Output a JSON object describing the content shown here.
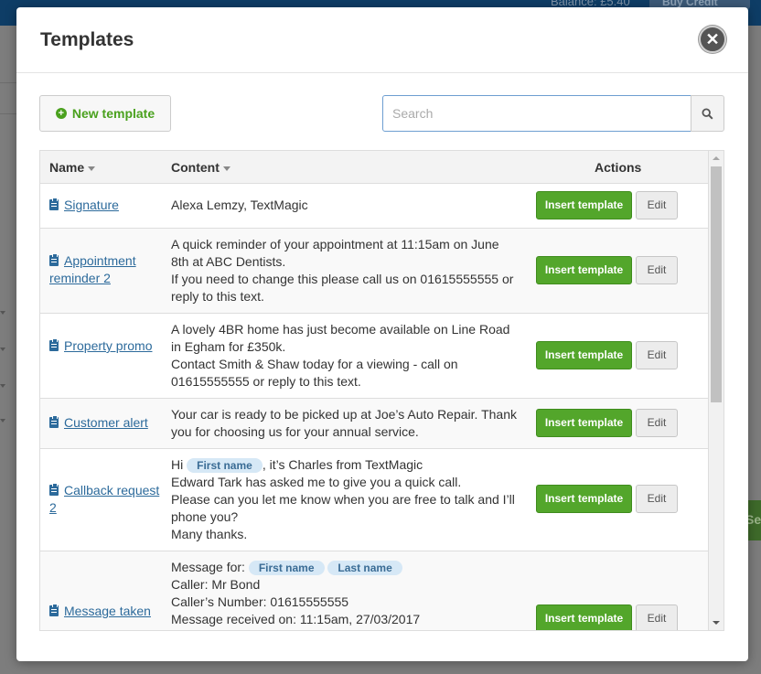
{
  "background": {
    "balance": "Balance: £5.40",
    "buy_credit": "Buy Credit",
    "side_button_fragment": "Se"
  },
  "modal": {
    "title": "Templates",
    "close_icon": "close-icon"
  },
  "toolbar": {
    "new_template_label": "New template",
    "search_placeholder": "Search"
  },
  "table": {
    "columns": {
      "name": "Name",
      "content": "Content",
      "actions": "Actions"
    },
    "insert_label": "Insert template",
    "edit_label": "Edit",
    "rows": [
      {
        "name": "Signature",
        "lines": [
          "Alexa Lemzy, TextMagic"
        ]
      },
      {
        "name": "Appointment reminder 2",
        "lines": [
          "A quick reminder of your appointment at 11:15am on June",
          "8th at ABC Dentists.",
          "If you need to change this please call us on 01615555555 or",
          "reply to this text."
        ]
      },
      {
        "name": "Property promo",
        "lines": [
          "A lovely 4BR home has just become available on Line Road",
          "in Egham for £350k.",
          "Contact Smith & Shaw today for a viewing - call on",
          "01615555555 or reply to this text."
        ]
      },
      {
        "name": "Customer alert",
        "lines": [
          "Your car is ready to be picked up at Joe’s Auto Repair. Thank",
          "you for choosing us for your annual service."
        ]
      },
      {
        "name": "Callback request 2",
        "greeting_pre": "Hi",
        "greeting_tag": "First name",
        "greeting_post": ", it’s Charles from TextMagic",
        "lines": [
          "Edward Tark has asked me to give you a quick call.",
          "Please can you let me know when you are free to talk and I’ll",
          "phone you?",
          "Many thanks."
        ]
      },
      {
        "name": "Message taken",
        "msg_for": "Message for:",
        "tag_first": "First name",
        "tag_last": "Last name",
        "lines": [
          "Caller: Mr Bond",
          "Caller’s Number: 01615555555",
          "Message received on: 11:15am, 27/03/2017"
        ]
      }
    ]
  }
}
